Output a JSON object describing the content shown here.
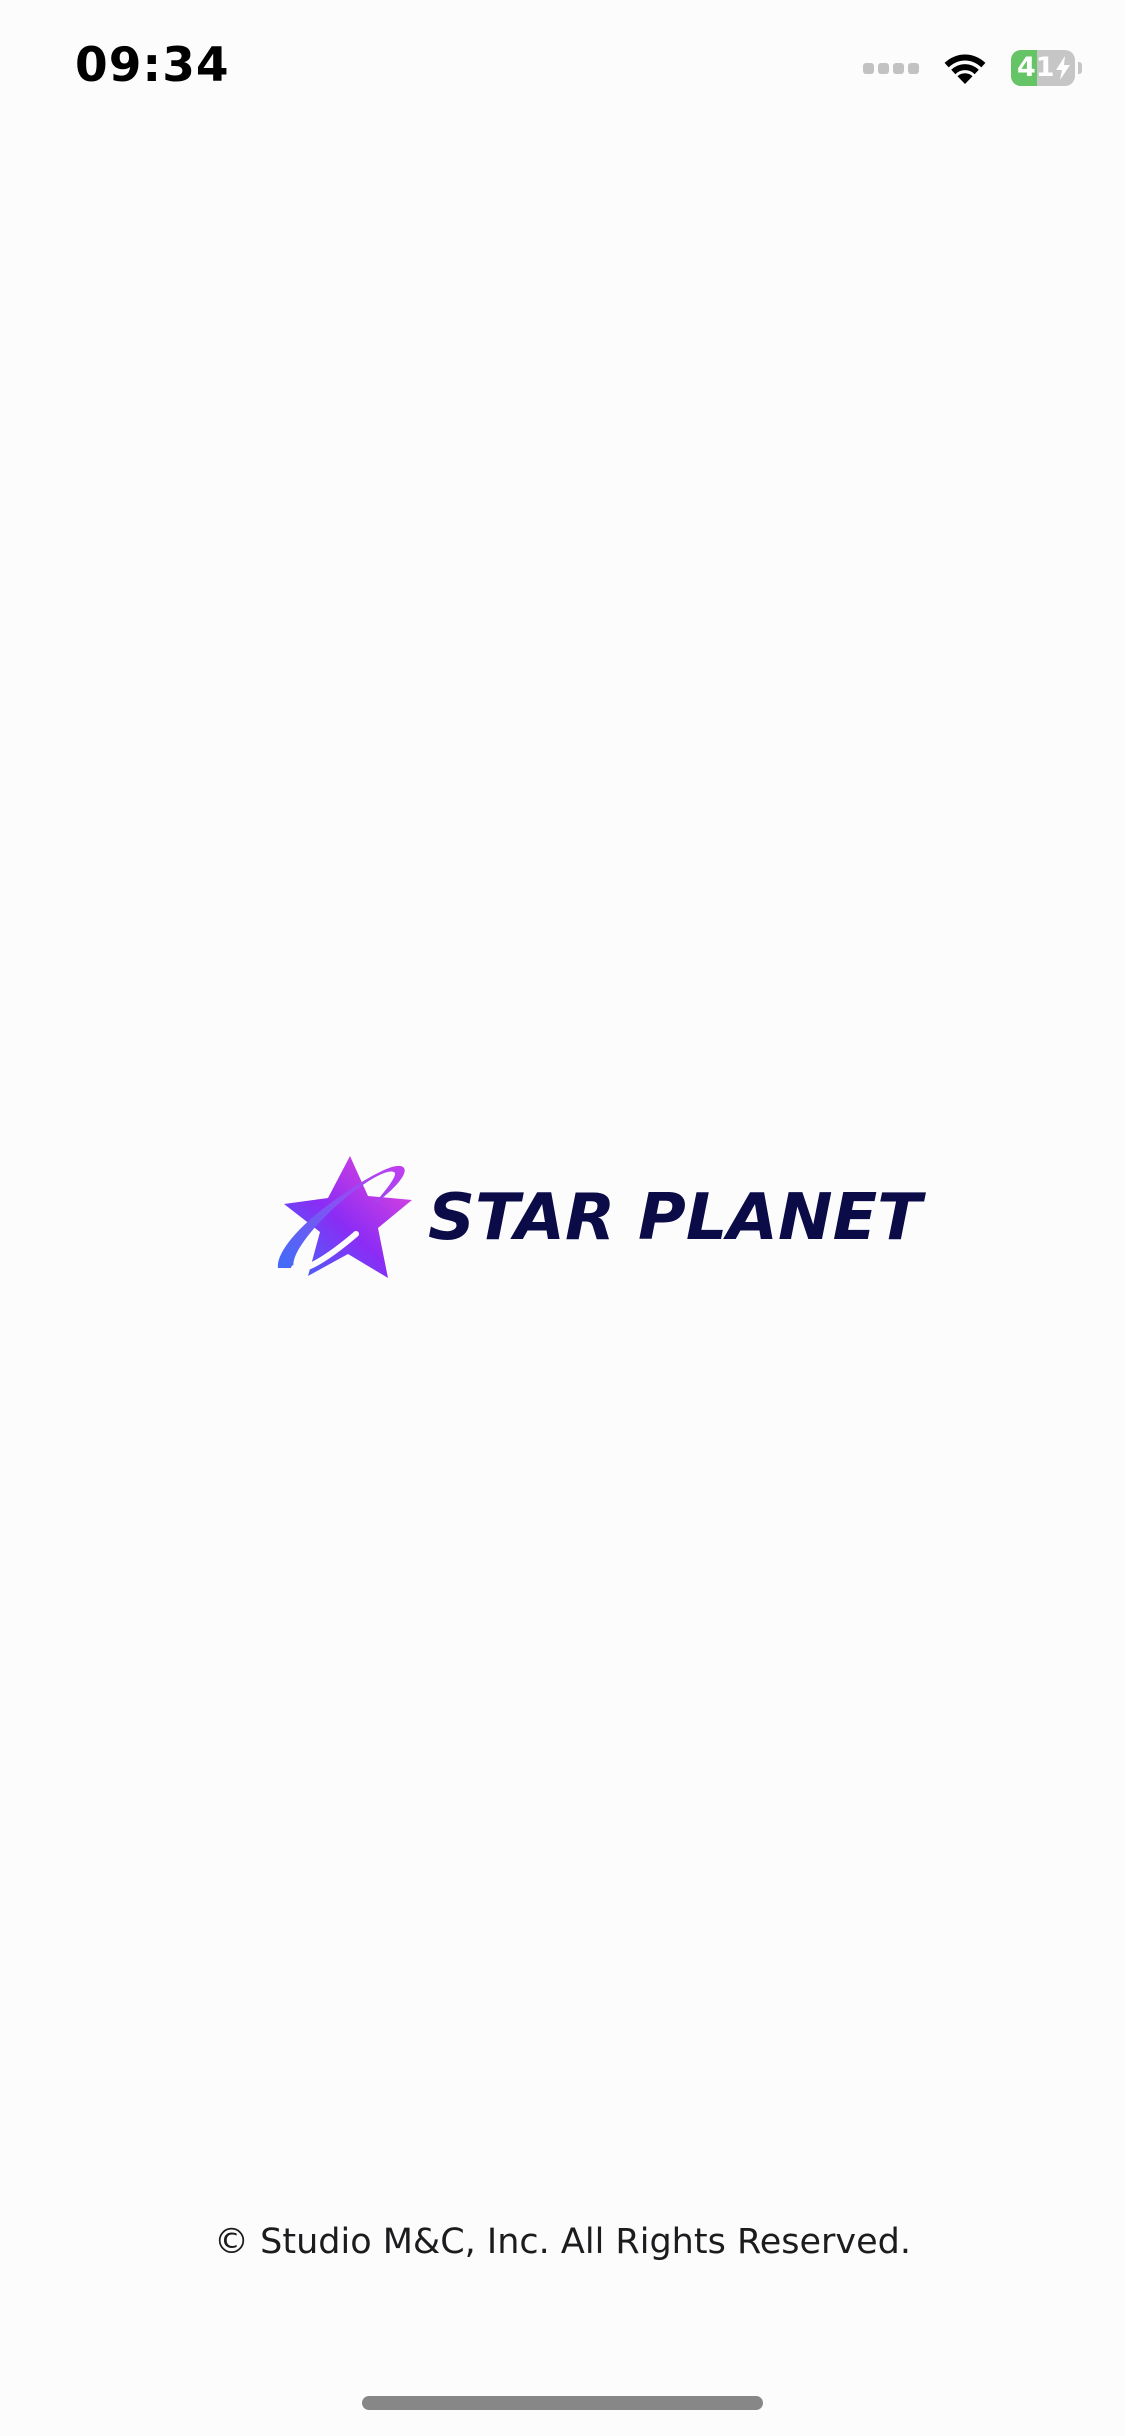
{
  "status_bar": {
    "time": "09:34",
    "battery_level": "41",
    "battery_fraction": 0.41,
    "charging": true,
    "icons": [
      "cellular-signal-icon",
      "wifi-icon",
      "battery-icon",
      "charging-bolt-icon"
    ]
  },
  "splash": {
    "logo_text": "STAR PLANET",
    "copyright": "© Studio M&C, Inc. All Rights Reserved."
  },
  "colors": {
    "background": "#fdfcfd",
    "logo_text": "#0b0b48",
    "logo_gradient_start": "#3f6cf7",
    "logo_gradient_mid": "#8b2cf5",
    "logo_gradient_end": "#f049d8",
    "battery_green": "#65c466"
  }
}
